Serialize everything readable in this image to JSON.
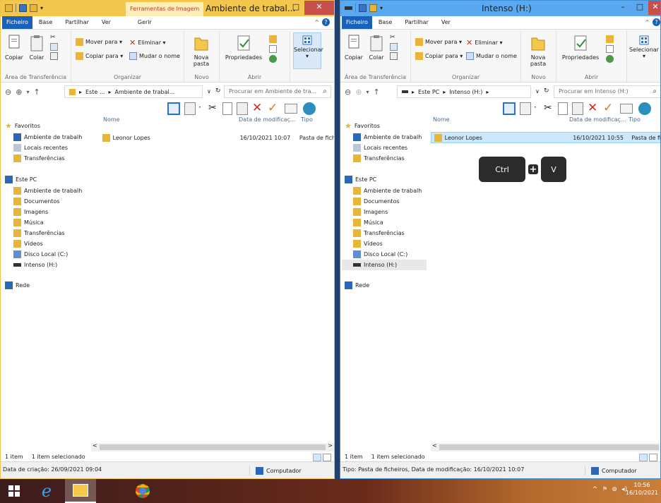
{
  "left": {
    "context_tab": "Ferramentas de Imagem",
    "title": "Ambiente de trabal...",
    "tabs": [
      "Ficheiro",
      "Base",
      "Partilhar",
      "Ver",
      "Gerir"
    ],
    "ribbon": {
      "copiar": "Copiar",
      "colar": "Colar",
      "clipboard_group": "Área de Transferência",
      "mover_para": "Mover para ▾",
      "copiar_para": "Copiar para ▾",
      "eliminar": "Eliminar ▾",
      "mudar_nome": "Mudar o nome",
      "organizar_group": "Organizar",
      "nova_pasta": "Nova pasta",
      "novo_group": "Novo",
      "propriedades": "Propriedades",
      "abrir_group": "Abrir",
      "selecionar": "Selecionar"
    },
    "address": {
      "crumb1": "Este ...",
      "crumb2": "Ambiente de trabal...",
      "search_placeholder": "Procurar em Ambiente de tra..."
    },
    "columns": [
      "Nome",
      "Data de modificaç...",
      "Tipo"
    ],
    "rows": [
      {
        "name": "Leonor Lopes",
        "date": "16/10/2021 10:07",
        "type": "Pasta de fich"
      }
    ],
    "status_count": "1 item",
    "status_selected": "1 item selecionado",
    "info_text": "Data de criação: 26/09/2021 09:04",
    "computer": "Computador"
  },
  "right": {
    "title": "Intenso (H:)",
    "tabs": [
      "Ficheiro",
      "Base",
      "Partilhar",
      "Ver"
    ],
    "ribbon": {
      "copiar": "Copiar",
      "colar": "Colar",
      "clipboard_group": "Área de Transferência",
      "mover_para": "Mover para ▾",
      "copiar_para": "Copiar para ▾",
      "eliminar": "Eliminar ▾",
      "mudar_nome": "Mudar o nome",
      "organizar_group": "Organizar",
      "nova_pasta": "Nova pasta",
      "novo_group": "Novo",
      "propriedades": "Propriedades",
      "abrir_group": "Abrir",
      "selecionar": "Selecionar"
    },
    "address": {
      "crumb1": "Este PC",
      "crumb2": "Intenso (H:)",
      "search_placeholder": "Procurar em Intenso (H:)"
    },
    "columns": [
      "Nome",
      "Data de modificaç...",
      "Tipo"
    ],
    "rows": [
      {
        "name": "Leonor Lopes",
        "date": "16/10/2021 10:55",
        "type": "Pasta de fi"
      }
    ],
    "status_count": "1 item",
    "status_selected": "1 item selecionado",
    "info_text": "Tipo: Pasta de ficheiros, Data de modificação: 16/10/2021 10:07",
    "computer": "Computador"
  },
  "nav": {
    "favoritos": "Favoritos",
    "fav_items": [
      "Ambiente de trabalh",
      "Locais recentes",
      "Transferências"
    ],
    "este_pc": "Este PC",
    "pc_items": [
      "Ambiente de trabalh",
      "Documentos",
      "Imagens",
      "Música",
      "Transferências",
      "Vídeos",
      "Disco Local (C:)",
      "Intenso (H:)"
    ],
    "rede": "Rede"
  },
  "shortcut": {
    "key1": "Ctrl",
    "plus": "+",
    "key2": "V"
  },
  "taskbar": {
    "time": "10:56",
    "date": "16/10/2021"
  },
  "colors": {
    "accent": "#1a62b8",
    "left_title": "#f3c64c",
    "right_title": "#5aa8ef"
  }
}
